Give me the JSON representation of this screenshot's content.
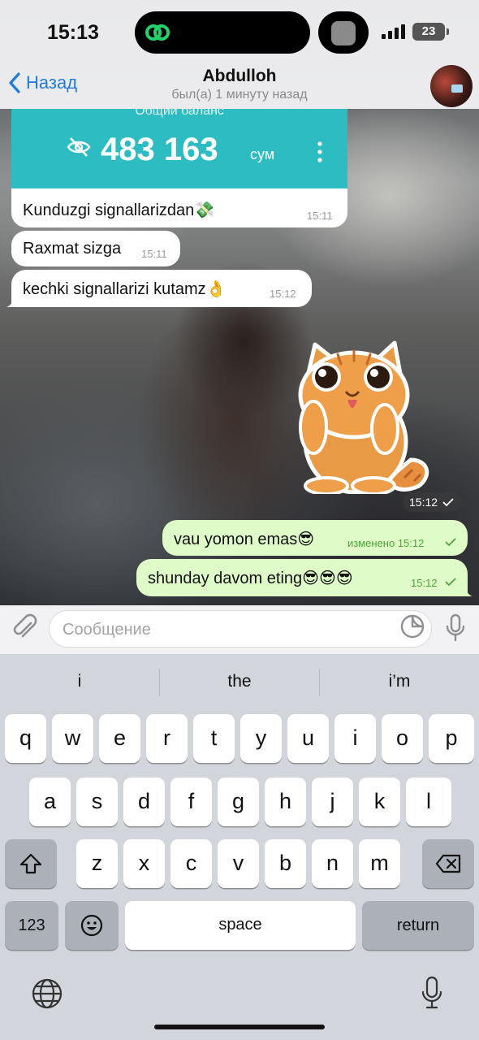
{
  "status_bar": {
    "time": "15:13",
    "battery": "23"
  },
  "header": {
    "back_label": "Назад",
    "contact_name": "Abdulloh",
    "last_seen": "был(а) 1 минуту назад"
  },
  "card": {
    "label": "Общий баланс",
    "amount": "483 163",
    "currency": "сум"
  },
  "messages": [
    {
      "text": "Kunduzgi signallarizdan💸",
      "time": "15:11",
      "direction": "in"
    },
    {
      "text": "Raxmat sizga",
      "time": "15:11",
      "direction": "in"
    },
    {
      "text": "kechki signallarizi kutamz👌",
      "time": "15:12",
      "direction": "in"
    },
    {
      "text": "vau yomon emas😎",
      "time": "изменено 15:12",
      "direction": "out"
    },
    {
      "text": "shunday davom eting😎😎😎",
      "time": "15:12",
      "direction": "out"
    }
  ],
  "sticker": {
    "time": "15:12",
    "icon": "cat-sticker"
  },
  "composer": {
    "placeholder": "Сообщение"
  },
  "keyboard": {
    "suggestions": [
      "i",
      "the",
      "i’m"
    ],
    "row1": [
      "q",
      "w",
      "e",
      "r",
      "t",
      "y",
      "u",
      "i",
      "o",
      "p"
    ],
    "row2": [
      "a",
      "s",
      "d",
      "f",
      "g",
      "h",
      "j",
      "k",
      "l"
    ],
    "row3": [
      "z",
      "x",
      "c",
      "v",
      "b",
      "n",
      "m"
    ],
    "numbers_label": "123",
    "space_label": "space",
    "return_label": "return"
  },
  "colors": {
    "accent": "#1f7bdc",
    "outgoing_bubble": "#dffbc8",
    "card": "#2cbcc2"
  }
}
